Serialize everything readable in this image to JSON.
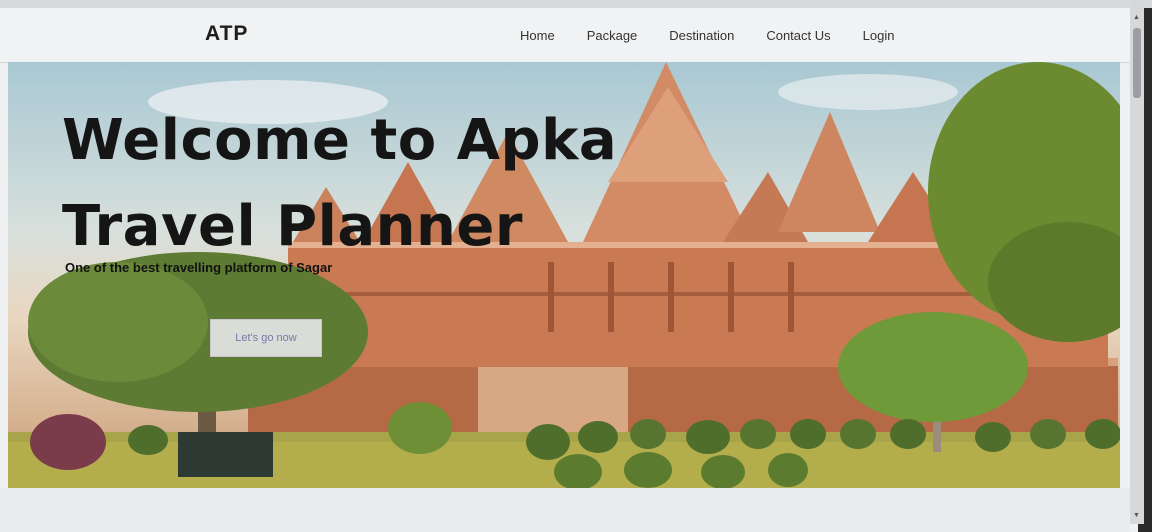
{
  "navbar": {
    "brand": "ATP",
    "links": [
      "Home",
      "Package",
      "Destination",
      "Contact Us",
      "Login"
    ]
  },
  "hero": {
    "title": "Welcome to Apka Travel Planner",
    "subtitle": "One of the best travelling platform of Sagar",
    "cta_label": "Let's go now"
  },
  "colors": {
    "title_text": "#151515",
    "cta_text": "#7b76a8",
    "temple_stone": "#c97a52"
  }
}
